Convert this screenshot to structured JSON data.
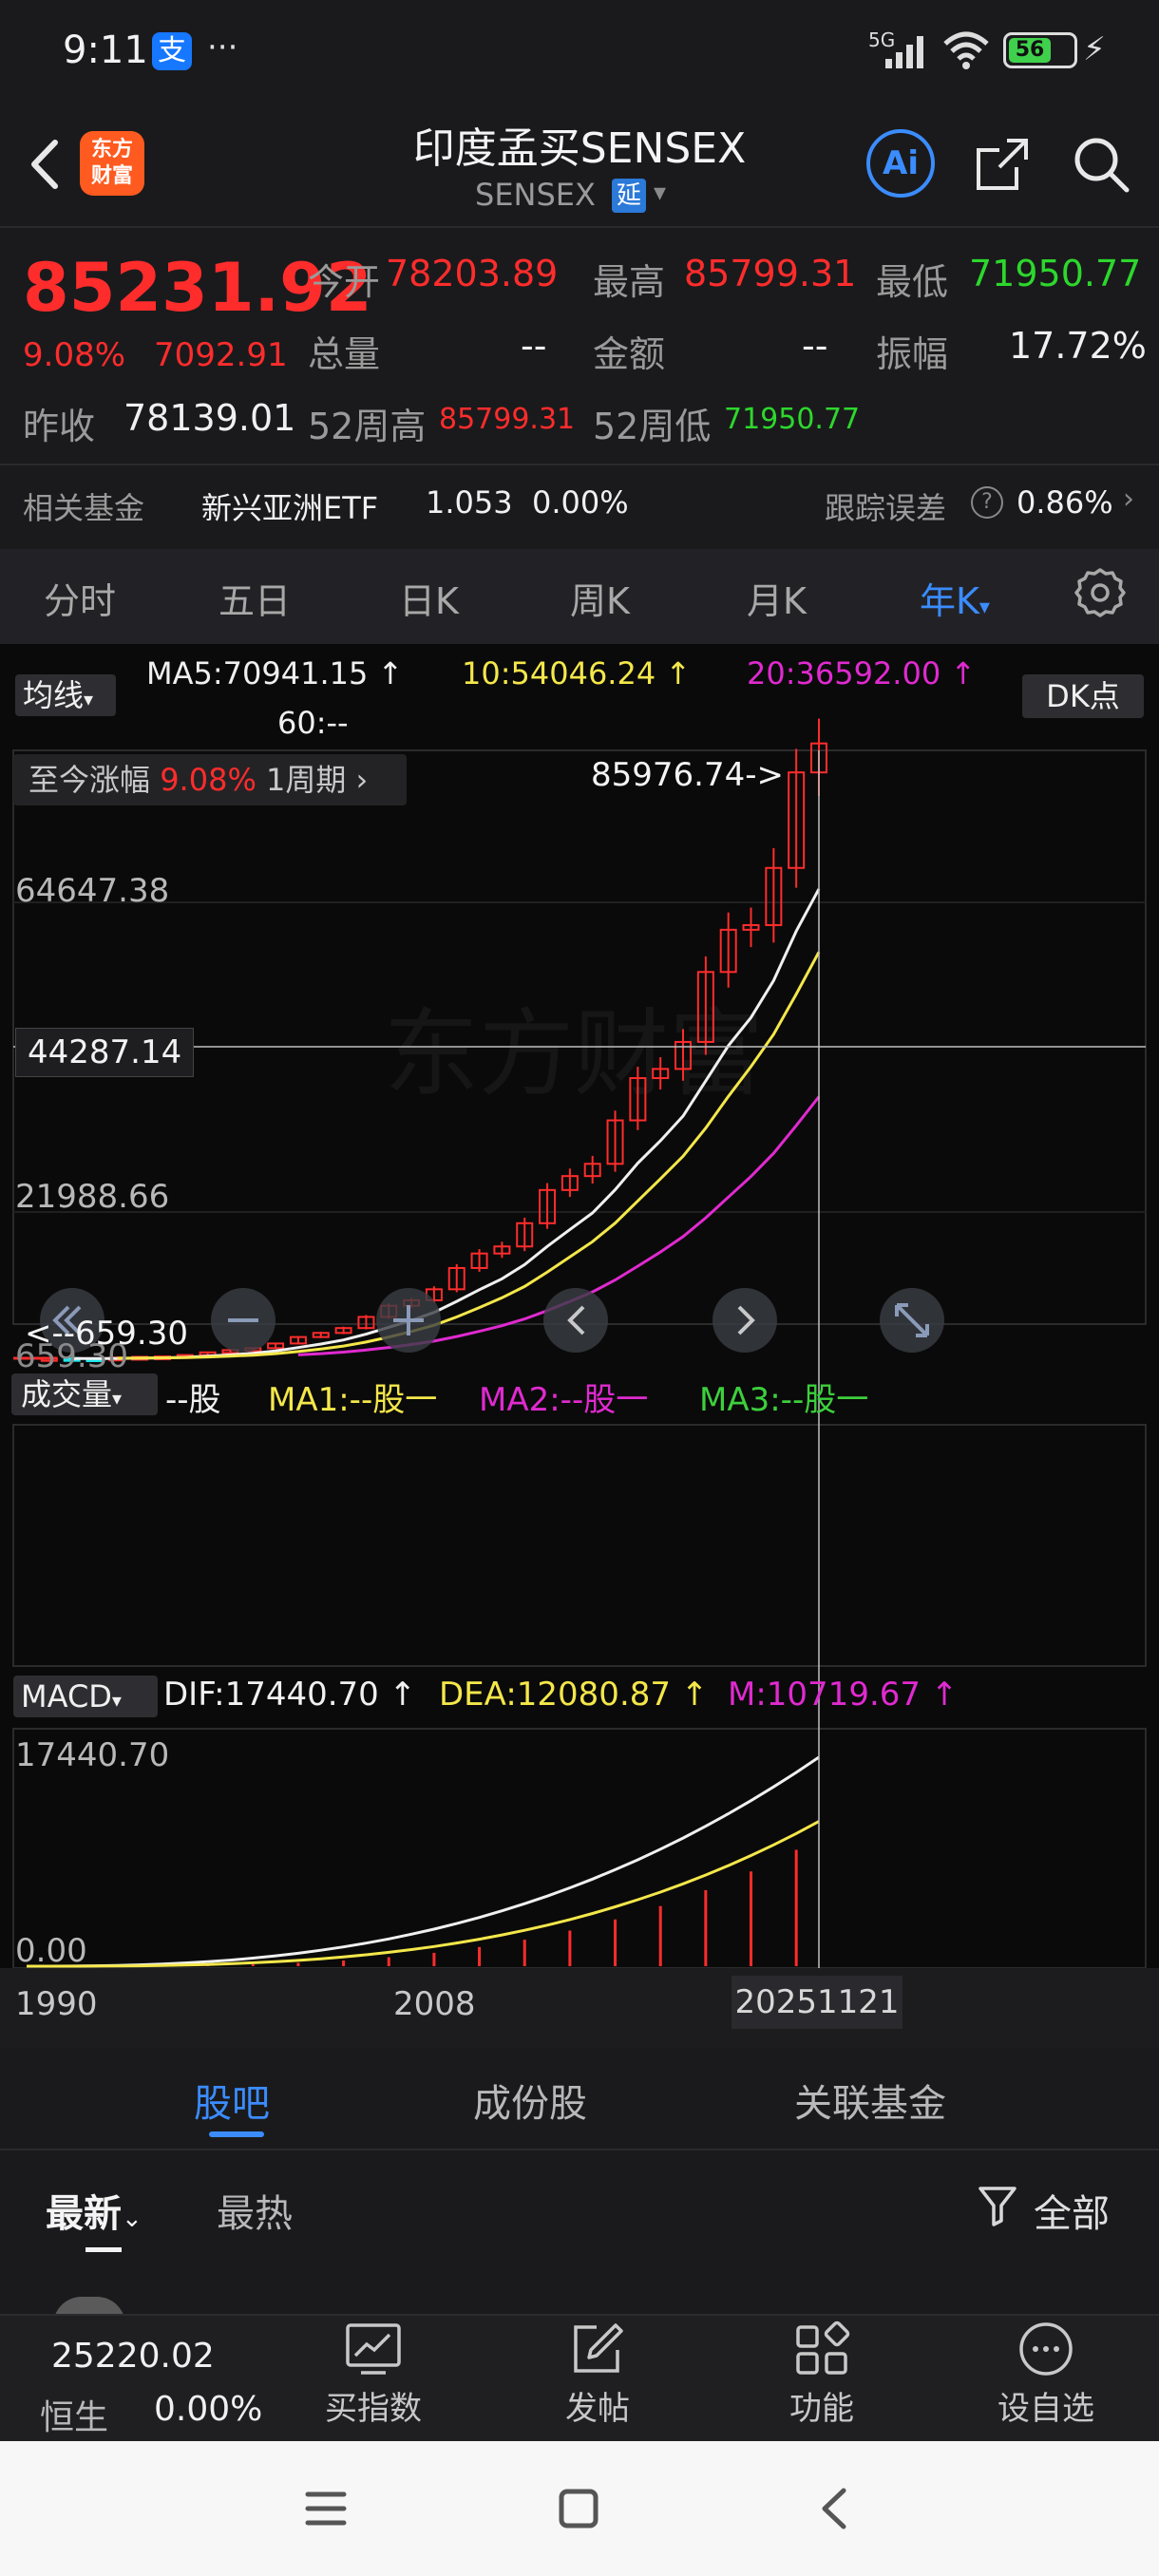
{
  "status_bar": {
    "time": "9:11",
    "alipay": "支",
    "more": "···",
    "network": "5G",
    "battery": "56"
  },
  "header": {
    "logo": [
      "东方",
      "财富"
    ],
    "title": "印度孟买SENSEX",
    "subtitle": "SENSEX",
    "delay_badge": "延",
    "ai_label": "Ai"
  },
  "quote": {
    "price": "85231.92",
    "change_pct": "9.08%",
    "change": "7092.91",
    "open_label": "今开",
    "open": "78203.89",
    "high_label": "最高",
    "high": "85799.31",
    "low_label": "最低",
    "low": "71950.77",
    "volume_label": "总量",
    "volume": "--",
    "amount_label": "金额",
    "amount": "--",
    "amplitude_label": "振幅",
    "amplitude": "17.72%",
    "prev_close_label": "昨收",
    "prev_close": "78139.01",
    "w52_high_label": "52周高",
    "w52_high": "85799.31",
    "w52_low_label": "52周低",
    "w52_low": "71950.77"
  },
  "fund": {
    "label": "相关基金",
    "name": "新兴亚洲ETF",
    "price": "1.053",
    "change": "0.00%",
    "track_label": "跟踪误差",
    "track_help": "?",
    "track_value": "0.86%",
    "chev": "›"
  },
  "periods": {
    "tabs": [
      "分时",
      "五日",
      "日K",
      "周K",
      "月K",
      "年K"
    ],
    "active_caret": "▾"
  },
  "chart": {
    "ma_button": "均线",
    "ma_caret": "▾",
    "ma5": "MA5:70941.15 ↑",
    "ma10": "10:54046.24 ↑",
    "ma20": "20:36592.00 ↑",
    "ma60": "60:--",
    "dk_button": "DK点",
    "since_label": "至今涨幅",
    "since_value": "9.08%",
    "since_period": "1周期 ›",
    "max_marker": "85976.74->",
    "min_marker": "<--659.30",
    "y_labels": [
      "64647.38",
      "21988.66",
      "659.30"
    ],
    "crosshair_value": "44287.14",
    "watermark": "东方财富"
  },
  "chart_data": {
    "type": "candlestick",
    "x_labels": [
      "1990",
      "2008",
      "20251121"
    ],
    "price_axis": {
      "labels": [
        64647.38,
        21988.66,
        659.3
      ],
      "crosshair": 44287.14,
      "max": 85976.74,
      "min": 659.3
    },
    "ma": {
      "MA5": 70941.15,
      "MA10": 54046.24,
      "MA20": 36592.0,
      "MA60": null
    },
    "macd": {
      "DIF": 17440.7,
      "DEA": 12080.87,
      "M": 10719.67,
      "y_labels": [
        17440.7,
        0.0
      ]
    }
  },
  "volume": {
    "button": "成交量",
    "unit": "--股",
    "ma1": "MA1:--股一",
    "ma2": "MA2:--股一",
    "ma3": "MA3:--股一"
  },
  "macd": {
    "button": "MACD",
    "dif": "DIF:17440.70 ↑",
    "dea": "DEA:12080.87 ↑",
    "m": "M:10719.67 ↑",
    "y_top": "17440.70",
    "y_zero": "0.00"
  },
  "x_axis": {
    "start": "1990",
    "mid": "2008",
    "current": "20251121"
  },
  "feature_tabs": [
    "股吧",
    "成份股",
    "关联基金"
  ],
  "feed": {
    "sort_new": "最新",
    "sort_hot": "最热",
    "filter_label": "全部"
  },
  "bottom_nav": {
    "index_value": "25220.02",
    "index_name": "恒生",
    "index_change": "0.00%",
    "items": [
      "买指数",
      "发帖",
      "功能",
      "设自选"
    ]
  },
  "colors": {
    "up": "#ff2c2c",
    "down": "#2dd72d",
    "accent": "#3b8cff",
    "ma5": "#f0f0f0",
    "ma10": "#f4e74a",
    "ma20": "#e02ad0",
    "ma3": "#3dcf3d",
    "bull_candle": "#1de5ea"
  }
}
